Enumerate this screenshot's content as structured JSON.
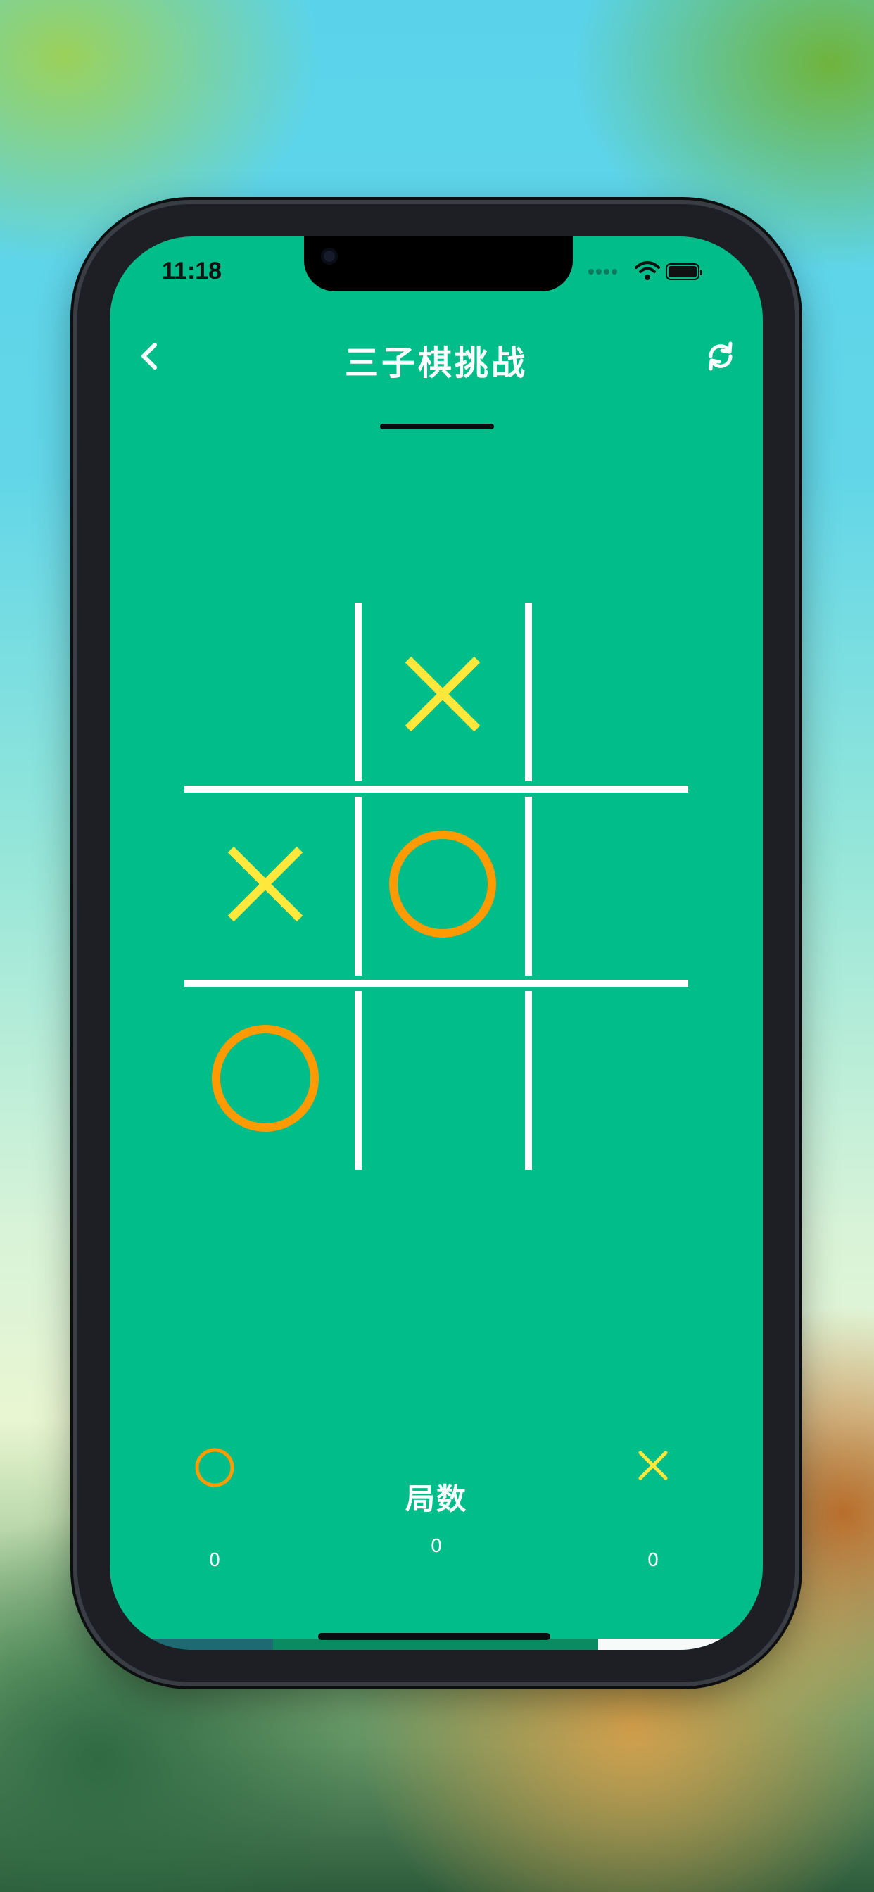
{
  "status_bar": {
    "time": "11:18"
  },
  "nav": {
    "title": "三子棋挑战",
    "back_icon": "chevron-left-icon",
    "refresh_icon": "refresh-icon"
  },
  "board": {
    "cells": [
      {
        "row": 0,
        "col": 0,
        "mark": ""
      },
      {
        "row": 0,
        "col": 1,
        "mark": "X"
      },
      {
        "row": 0,
        "col": 2,
        "mark": ""
      },
      {
        "row": 1,
        "col": 0,
        "mark": "X"
      },
      {
        "row": 1,
        "col": 1,
        "mark": "O"
      },
      {
        "row": 1,
        "col": 2,
        "mark": ""
      },
      {
        "row": 2,
        "col": 0,
        "mark": "O"
      },
      {
        "row": 2,
        "col": 1,
        "mark": ""
      },
      {
        "row": 2,
        "col": 2,
        "mark": ""
      }
    ]
  },
  "score": {
    "label": "局数",
    "o_score": "0",
    "rounds": "0",
    "x_score": "0"
  },
  "colors": {
    "background": "#00bd8a",
    "x_mark": "#ffe83b",
    "o_mark": "#ff9a00",
    "grid": "#ffffff"
  }
}
